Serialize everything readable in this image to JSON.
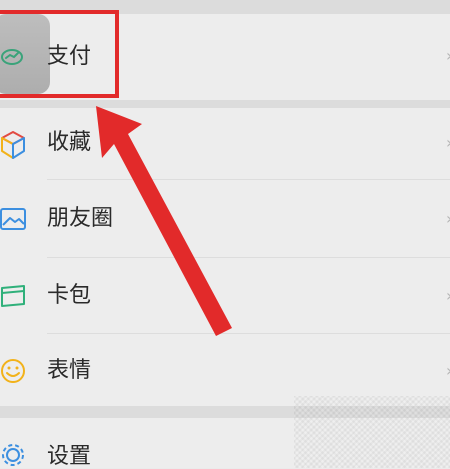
{
  "menu": {
    "items": [
      {
        "label": "支付",
        "icon": "wallet-icon"
      },
      {
        "label": "收藏",
        "icon": "favorites-cube-icon"
      },
      {
        "label": "朋友圈",
        "icon": "moments-image-icon"
      },
      {
        "label": "卡包",
        "icon": "card-pack-icon"
      },
      {
        "label": "表情",
        "icon": "emoji-smile-icon"
      },
      {
        "label": "设置",
        "icon": "gear-icon"
      }
    ]
  },
  "annotation": {
    "highlight_color": "#e22a2a"
  }
}
